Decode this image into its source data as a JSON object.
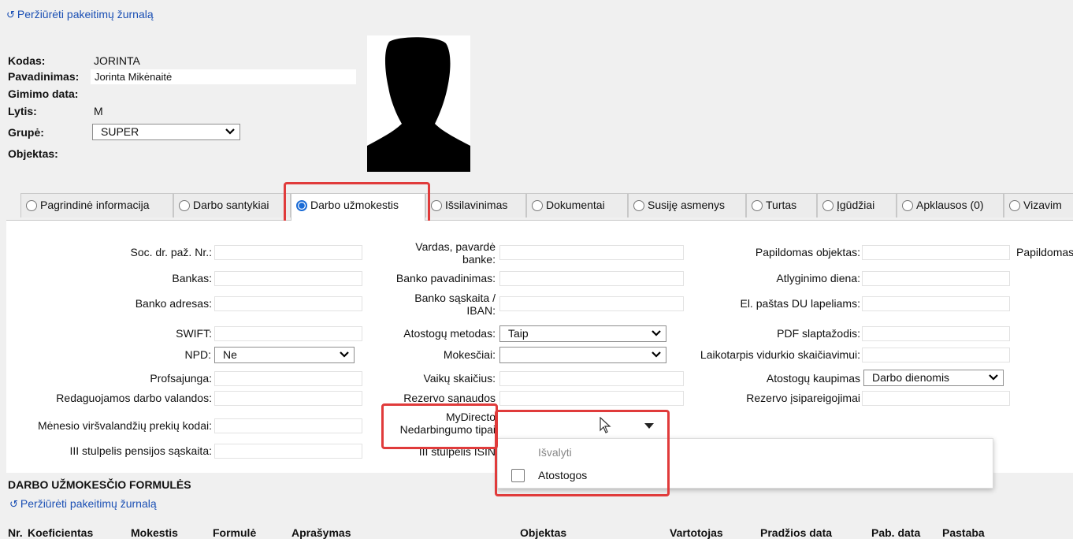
{
  "history_link": "Peržiūrėti pakeitimų žurnalą",
  "employee": {
    "code_label": "Kodas:",
    "code_value": "JORINTA",
    "name_label": "Pavadinimas:",
    "name_value": "Jorinta Mikėnaitė",
    "birth_label": "Gimimo data:",
    "gender_label": "Lytis:",
    "gender_value": "M",
    "group_label": "Grupė:",
    "group_value": "SUPER",
    "object_label": "Objektas:"
  },
  "tabs": [
    {
      "label": "Pagrindinė informacija",
      "active": false
    },
    {
      "label": "Darbo santykiai",
      "active": false
    },
    {
      "label": "Darbo užmokestis",
      "active": true
    },
    {
      "label": "Išsilavinimas",
      "active": false
    },
    {
      "label": "Dokumentai",
      "active": false
    },
    {
      "label": "Susiję asmenys",
      "active": false
    },
    {
      "label": "Turtas",
      "active": false
    },
    {
      "label": "Įgūdžiai",
      "active": false
    },
    {
      "label": "Apklausos (0)",
      "active": false
    },
    {
      "label": "Vizavim",
      "active": false
    }
  ],
  "col1": {
    "soc": "Soc. dr. paž. Nr.:",
    "bank": "Bankas:",
    "bank_address": "Banko adresas:",
    "swift": "SWIFT:",
    "npd": "NPD:",
    "npd_value": "Ne",
    "union": "Profsajunga:",
    "editable_hours": "Redaguojamos darbo valandos:",
    "overtime_codes": "Mėnesio viršvalandžių prekių kodai:",
    "pension_account": "III stulpelis pensijos sąskaita:"
  },
  "col2": {
    "name_in_bank": "Vardas, pavardė banke:",
    "bank_name": "Banko pavadinimas:",
    "bank_account": "Banko sąskaita / IBAN:",
    "vacation_method": "Atostogų metodas:",
    "vacation_method_value": "Taip",
    "taxes": "Mokesčiai:",
    "children": "Vaikų skaičius:",
    "reserve_costs": "Rezervo sąnaudos",
    "mydirecto_line1": "MyDirecto",
    "mydirecto_line2": "Nedarbingumo tipai",
    "isin": "III stulpelis ISIN"
  },
  "col3": {
    "extra_object": "Papildomas objektas:",
    "pay_day": "Atlyginimo diena:",
    "email": "El. paštas DU lapeliams:",
    "pdf_password": "PDF slaptažodis:",
    "avg_period": "Laikotarpis vidurkio skaičiavimui:",
    "vacation_accrual": "Atostogų kaupimas",
    "vacation_accrual_value": "Darbo dienomis",
    "reserve_obligations": "Rezervo įsipareigojimai"
  },
  "col4": {
    "extra_cut": "Papildomas"
  },
  "dropdown": {
    "clear": "Išvalyti",
    "options": [
      "Atostogos"
    ]
  },
  "formulas": {
    "title": "DARBO UŽMOKESČIO FORMULĖS",
    "history_link": "Peržiūrėti pakeitimų žurnalą",
    "headers": [
      "Nr.",
      "Koeficientas",
      "Mokestis",
      "Formulė",
      "Aprašymas",
      "Objektas",
      "Vartotojas",
      "Pradžios data",
      "Pab. data",
      "Pastaba"
    ]
  },
  "colors": {
    "link": "#1a4fb4",
    "highlight": "#e03b3b",
    "radio_active": "#1a6bd6"
  }
}
